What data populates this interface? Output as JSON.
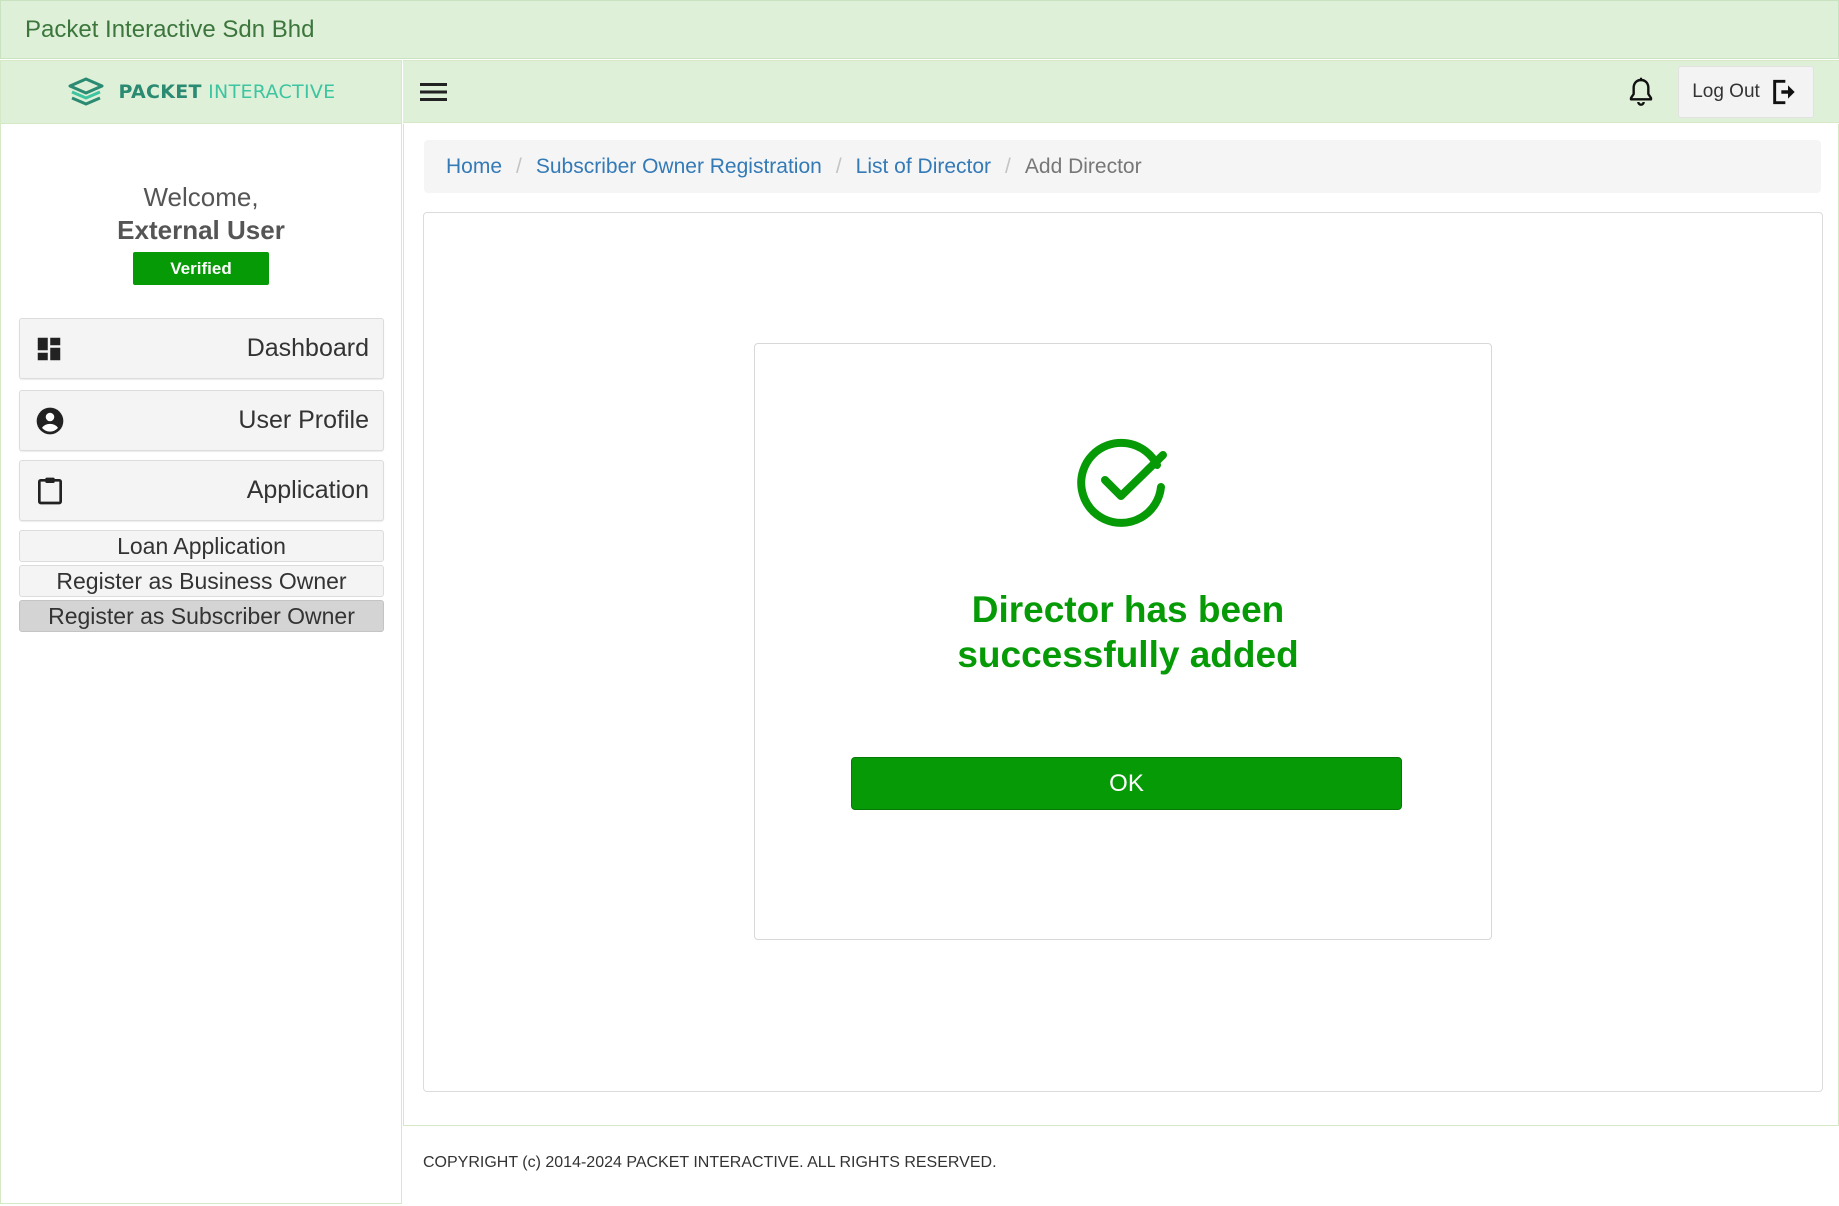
{
  "window": {
    "title": "Packet Interactive Sdn Bhd"
  },
  "brand": {
    "name_bold": "PACKET",
    "name_light": "INTERACTIVE",
    "color_dark": "#2a8a72",
    "color_light": "#3cc5a0"
  },
  "user": {
    "welcome": "Welcome,",
    "name": "External User",
    "status_badge": "Verified"
  },
  "sidebar": {
    "items": [
      {
        "label": "Dashboard",
        "icon": "dashboard-icon"
      },
      {
        "label": "User Profile",
        "icon": "account-circle-icon"
      },
      {
        "label": "Application",
        "icon": "clipboard-icon"
      }
    ],
    "sub_items": [
      {
        "label": "Loan Application",
        "active": false
      },
      {
        "label": "Register as Business Owner",
        "active": false
      },
      {
        "label": "Register as Subscriber Owner",
        "active": true
      }
    ]
  },
  "header": {
    "menu_icon": "hamburger-icon",
    "notification_icon": "bell-icon",
    "logout_label": "Log Out",
    "logout_icon": "logout-icon"
  },
  "breadcrumb": {
    "links": [
      "Home",
      "Subscriber Owner Registration",
      "List of Director"
    ],
    "current": "Add Director"
  },
  "dialog": {
    "icon": "check-circle-icon",
    "message_line1": "Director has been",
    "message_line2": "successfully added",
    "ok_label": "OK"
  },
  "footer": {
    "copyright": "COPYRIGHT (c) 2014-2024 PACKET INTERACTIVE. ALL RIGHTS RESERVED."
  },
  "colors": {
    "accent_green": "#079a07",
    "header_bg": "#dff0d8",
    "title_text": "#3c763d",
    "link": "#337ab7"
  }
}
